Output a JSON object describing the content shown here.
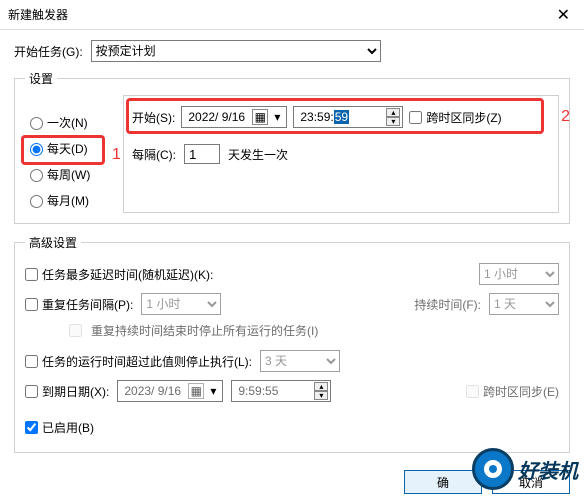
{
  "titlebar": {
    "title": "新建触发器",
    "close": "✕"
  },
  "task": {
    "label": "开始任务(G):",
    "selected": "按预定计划"
  },
  "settings": {
    "legend": "设置",
    "radios": {
      "once": "一次(N)",
      "daily": "每天(D)",
      "weekly": "每周(W)",
      "monthly": "每月(M)"
    },
    "start_label": "开始(S):",
    "date": "2022/ 9/16",
    "time_prefix": "23:59:",
    "time_sel": "59",
    "sync_tz": "跨时区同步(Z)",
    "interval_label": "每隔(C):",
    "interval_value": "1",
    "interval_suffix": "天发生一次",
    "ann1": "1",
    "ann2": "2"
  },
  "adv": {
    "legend": "高级设置",
    "delay_label": "任务最多延迟时间(随机延迟)(K):",
    "delay_value": "1 小时",
    "repeat_label": "重复任务间隔(P):",
    "repeat_value": "1 小时",
    "duration_label": "持续时间(F):",
    "duration_value": "1 天",
    "stop_running_label": "重复持续时间结束时停止所有运行的任务(I)",
    "stop_after_label": "任务的运行时间超过此值则停止执行(L):",
    "stop_after_value": "3 天",
    "expire_label": "到期日期(X):",
    "expire_date": "2023/ 9/16",
    "expire_time": "9:59:55",
    "expire_tz": "跨时区同步(E)",
    "enabled_label": "已启用(B)"
  },
  "buttons": {
    "ok": "确",
    "cancel": "取消"
  },
  "watermark": "好装机"
}
